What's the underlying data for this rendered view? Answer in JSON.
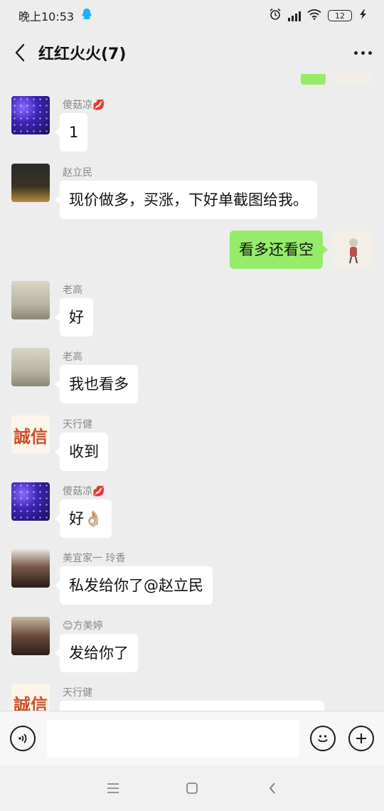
{
  "status_bar": {
    "time": "晚上10:53",
    "battery": "12"
  },
  "header": {
    "title": "红红火火(7)"
  },
  "messages": [
    {
      "sender": "傻菇凉💋",
      "text": "1"
    },
    {
      "sender": "赵立民",
      "text": "现价做多，买涨，下好单截图给我。"
    },
    {
      "sender": "",
      "text": "看多还看空"
    },
    {
      "sender": "老高",
      "text": "好"
    },
    {
      "sender": "老高",
      "text": "我也看多"
    },
    {
      "sender": "天行健",
      "text": "收到"
    },
    {
      "sender": "傻菇凉💋",
      "text": "好👌🏼"
    },
    {
      "sender": "美宜家一 玲香",
      "text": "私发给你了@赵立民"
    },
    {
      "sender": "😊方美婷",
      "text": "发给你了"
    },
    {
      "sender": "天行健",
      "text": ""
    }
  ],
  "avatar_text": {
    "cheng": "誠信"
  },
  "colors": {
    "background": "#ededed",
    "self_bubble": "#95ec69",
    "other_bubble": "#ffffff"
  },
  "icons": [
    "chevron-left-icon",
    "more-dots-icon",
    "voice-icon",
    "emoji-icon",
    "plus-icon",
    "menu-icon",
    "home-icon",
    "back-nav-icon"
  ]
}
